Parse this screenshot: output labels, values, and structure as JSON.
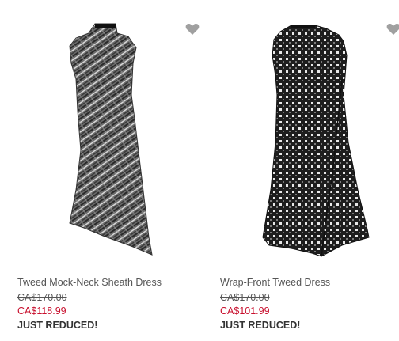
{
  "colors": {
    "sale_price": "#c8102e",
    "wishlist_icon": "#a0a0a0"
  },
  "products": [
    {
      "name": "Tweed Mock-Neck Sheath Dress",
      "original_price": "CA$170.00",
      "sale_price": "CA$118.99",
      "badge": "JUST REDUCED!",
      "icon": "heart-icon"
    },
    {
      "name": "Wrap-Front Tweed Dress",
      "original_price": "CA$170.00",
      "sale_price": "CA$101.99",
      "badge": "JUST REDUCED!",
      "icon": "heart-icon"
    }
  ]
}
